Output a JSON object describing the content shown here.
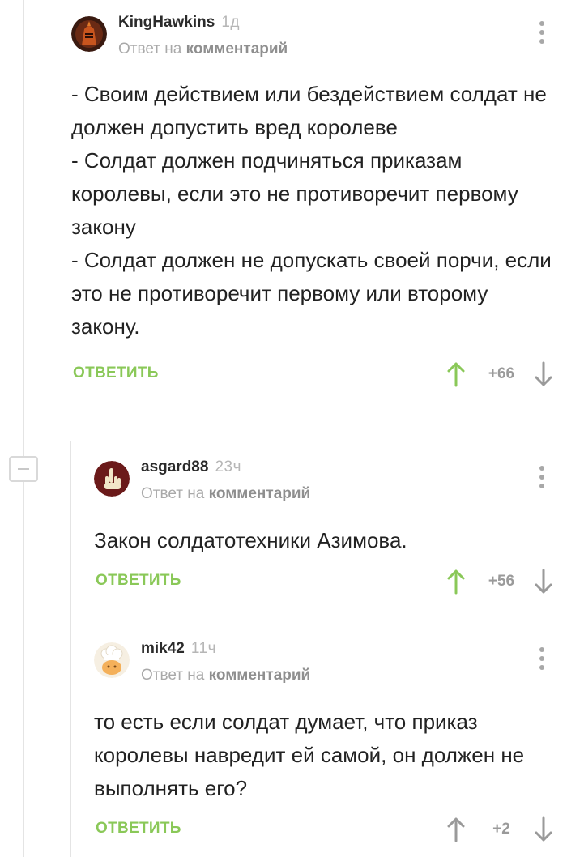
{
  "comments": [
    {
      "author": "KingHawkins",
      "time": "1д",
      "reply_prefix": "Ответ на",
      "reply_link": "комментарий",
      "avatar_icon": "knight-helmet-avatar",
      "lines": [
        "- Своим действием или бездействием солдат не должен допустить вред королеве",
        "- Солдат должен подчиняться приказам королевы, если это не противоречит первому закону",
        "- Солдат должен не допускать своей порчи, если это не противоречит первому или второму закону."
      ],
      "reply_label": "ОТВЕТИТЬ",
      "rating": "+66",
      "up_active": true
    },
    {
      "author": "asgard88",
      "time": "23ч",
      "reply_prefix": "Ответ на",
      "reply_link": "комментарий",
      "avatar_icon": "middle-finger-avatar",
      "lines": [
        "Закон солдатотехники Азимова."
      ],
      "reply_label": "ОТВЕТИТЬ",
      "rating": "+56",
      "up_active": true
    },
    {
      "author": "mik42",
      "time": "11ч",
      "reply_prefix": "Ответ на",
      "reply_link": "комментарий",
      "avatar_icon": "chef-avatar",
      "lines": [
        "то есть если солдат думает, что приказ королевы навредит ей самой, он должен не выполнять его?"
      ],
      "reply_label": "ОТВЕТИТЬ",
      "rating": "+2",
      "up_active": false
    }
  ],
  "colors": {
    "accent_green": "#8ac858",
    "arrow_gray": "#9a9a9a",
    "thread_line": "#e4e4e4"
  }
}
